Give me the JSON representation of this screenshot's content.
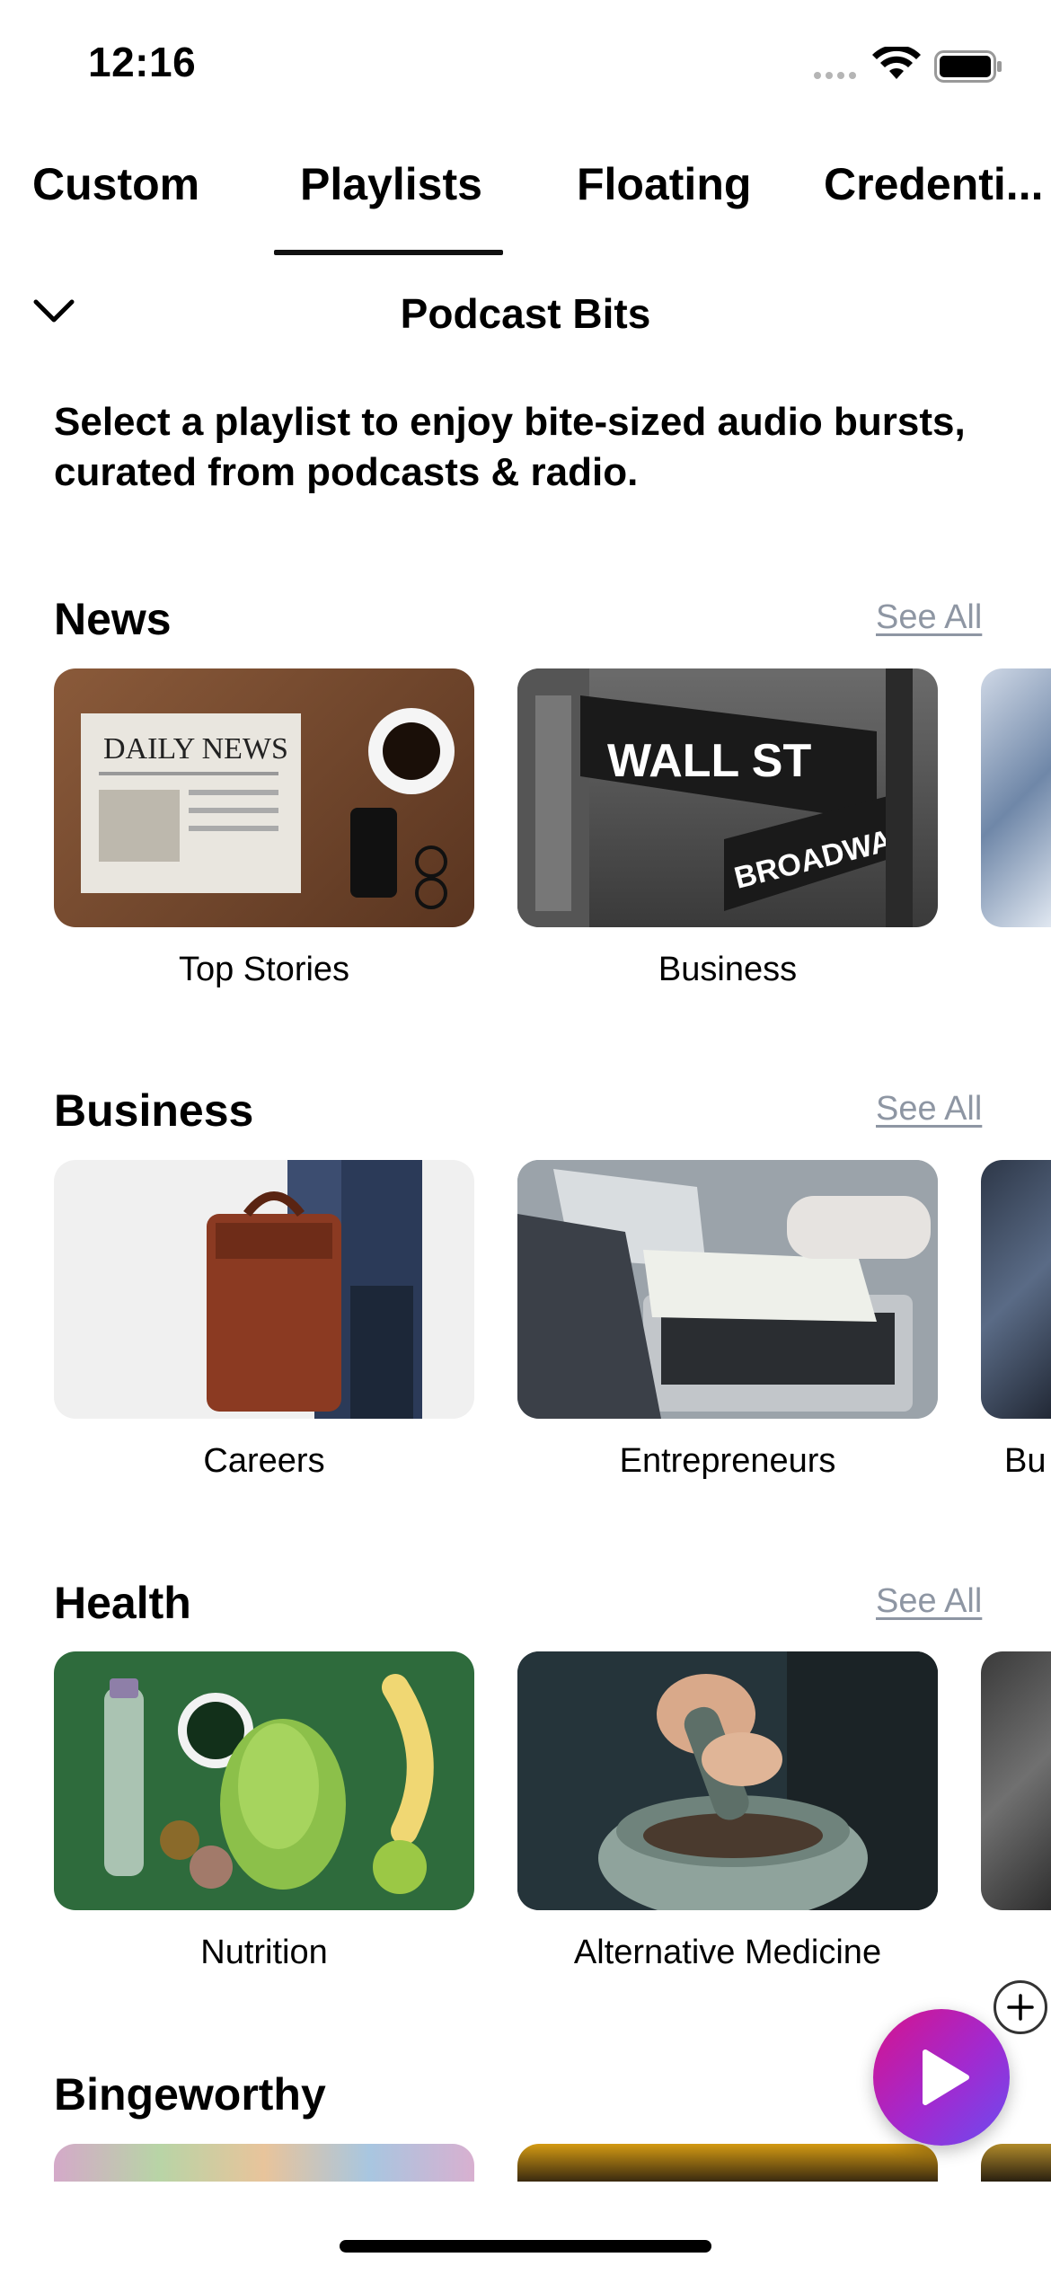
{
  "status_bar": {
    "time": "12:16",
    "wifi_icon": "wifi-icon",
    "battery_icon": "battery-icon"
  },
  "tabs": [
    {
      "label": "Custom"
    },
    {
      "label": "Playlists",
      "selected": true
    },
    {
      "label": "Floating"
    },
    {
      "label": "Credenti..."
    }
  ],
  "header": {
    "title": "Podcast Bits",
    "collapse_icon": "chevron-down-icon"
  },
  "intro": "Select a playlist to enjoy bite-sized audio bursts, curated from podcasts & radio.",
  "sections": [
    {
      "title": "News",
      "see_all": "See All",
      "items": [
        {
          "label": "Top Stories"
        },
        {
          "label": "Business"
        }
      ]
    },
    {
      "title": "Business",
      "see_all": "See All",
      "items": [
        {
          "label": "Careers"
        },
        {
          "label": "Entrepreneurs"
        },
        {
          "label": "Bu"
        }
      ]
    },
    {
      "title": "Health",
      "see_all": "See All",
      "items": [
        {
          "label": "Nutrition"
        },
        {
          "label": "Alternative Medicine"
        }
      ]
    },
    {
      "title": "Bingeworthy"
    }
  ],
  "fab": {
    "icon": "play-icon"
  },
  "plus_button": {
    "icon": "plus-icon"
  },
  "colors": {
    "see_all": "#8e96a3",
    "fab_start": "#d6138c",
    "fab_end": "#6b4cf0"
  }
}
